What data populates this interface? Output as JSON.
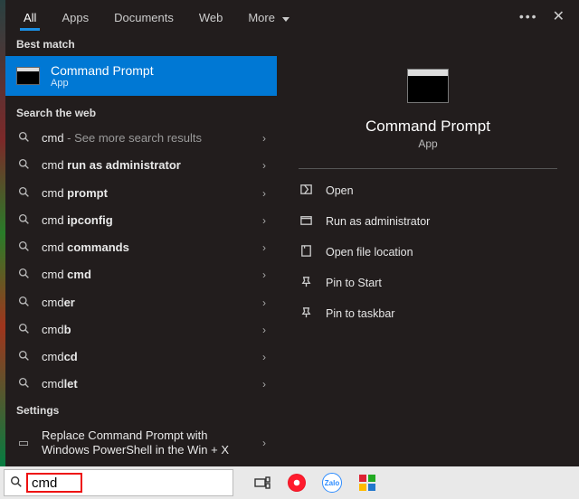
{
  "tabs": {
    "all": "All",
    "apps": "Apps",
    "documents": "Documents",
    "web": "Web",
    "more": "More"
  },
  "sections": {
    "best_match": "Best match",
    "search_web": "Search the web",
    "settings": "Settings"
  },
  "best": {
    "title": "Command Prompt",
    "subtitle": "App"
  },
  "web_results": [
    {
      "prefix": "cmd",
      "bold": "",
      "suffix": " - See more search results"
    },
    {
      "prefix": "cmd ",
      "bold": "run as administrator",
      "suffix": ""
    },
    {
      "prefix": "cmd ",
      "bold": "prompt",
      "suffix": ""
    },
    {
      "prefix": "cmd ",
      "bold": "ipconfig",
      "suffix": ""
    },
    {
      "prefix": "cmd ",
      "bold": "commands",
      "suffix": ""
    },
    {
      "prefix": "cmd ",
      "bold": "cmd",
      "suffix": ""
    },
    {
      "prefix": "cmd",
      "bold": "er",
      "suffix": ""
    },
    {
      "prefix": "cmd",
      "bold": "b",
      "suffix": ""
    },
    {
      "prefix": "cmd",
      "bold": "cd",
      "suffix": ""
    },
    {
      "prefix": "cmd",
      "bold": "let",
      "suffix": ""
    }
  ],
  "settings_item": "Replace Command Prompt with Windows PowerShell in the Win + X",
  "detail": {
    "title": "Command Prompt",
    "type": "App",
    "actions": {
      "open": "Open",
      "run_admin": "Run as administrator",
      "open_loc": "Open file location",
      "pin_start": "Pin to Start",
      "pin_taskbar": "Pin to taskbar"
    }
  },
  "search": {
    "query": "cmd"
  },
  "taskbar": {
    "zalo": "Zalo"
  }
}
